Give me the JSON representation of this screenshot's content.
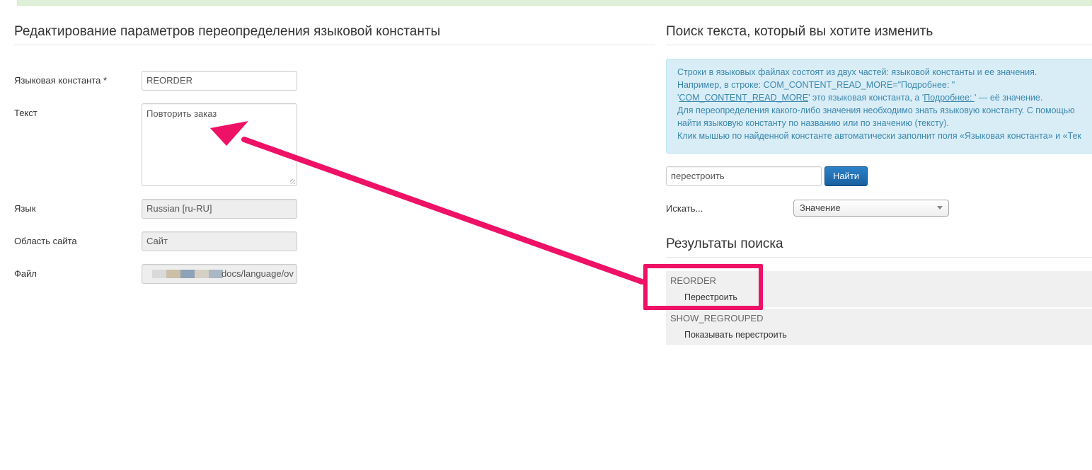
{
  "left": {
    "title": "Редактирование параметров переопределения языковой константы",
    "fields": {
      "constant_label": "Языковая константа *",
      "constant_value": "REORDER",
      "text_label": "Текст",
      "text_value": "Повторить заказ",
      "language_label": "Язык",
      "language_value": "Russian [ru-RU]",
      "area_label": "Область сайта",
      "area_value": "Сайт",
      "file_label": "Файл",
      "file_value": "docs/language/ov"
    }
  },
  "right": {
    "title": "Поиск текста, который вы хотите изменить",
    "info": {
      "line1": "Строки в языковых файлах состоят из двух частей: языковой константы и ее значения.",
      "line2": "Например, в строке: COM_CONTENT_READ_MORE=\"Подробнее: \"",
      "line3_quote1": "'",
      "line3_const": "COM_CONTENT_READ_MORE",
      "line3_mid": "' это языковая константа, а '",
      "line3_value": "Подробнее: ",
      "line3_end": "' — её значение.",
      "line4": "Для переопределения какого-либо значения необходимо знать языковую константу. С помощью",
      "line5": "найти языковую константу по названию или по значению (тексту).",
      "line6": "Клик мышью по найденной константе автоматически заполнит поля «Языковая константа» и «Тек"
    },
    "search": {
      "value": "перестроить",
      "button": "Найти"
    },
    "search_in_label": "Искать...",
    "search_in_value": "Значение",
    "results_title": "Результаты поиска",
    "results": [
      {
        "constant": "REORDER",
        "value": "Перестроить"
      },
      {
        "constant": "SHOW_REGROUPED",
        "value": "Показывать перестроить"
      }
    ]
  },
  "colors": {
    "annotation": "#ee1166",
    "info_bg": "#d9edf7",
    "info_text": "#3a87ad",
    "button": "#1a5f9e"
  }
}
